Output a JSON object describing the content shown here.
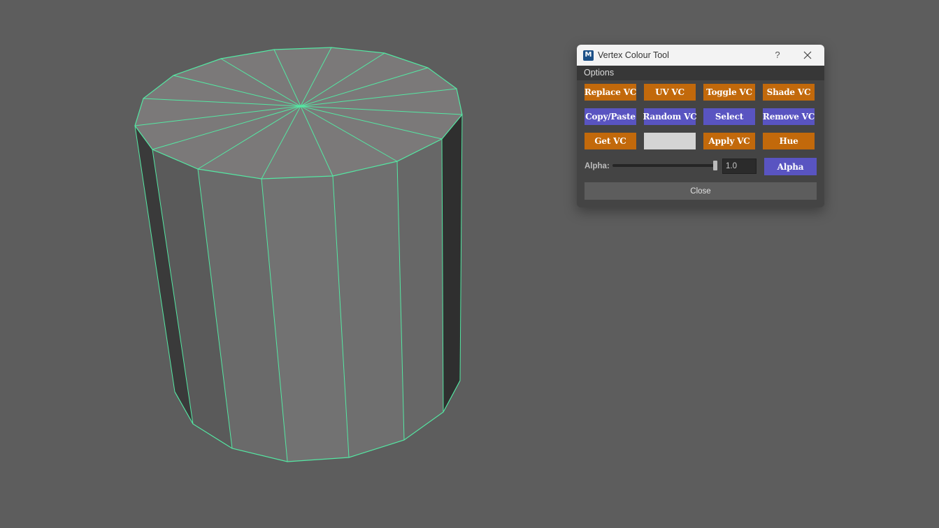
{
  "colors": {
    "viewport_bg": "#5d5d5d",
    "wireframe": "#54e8a3",
    "orange": "#c2690b",
    "purple": "#5954c1",
    "swatch": "#d4d4d4"
  },
  "viewport": {
    "object": "cylinder"
  },
  "window": {
    "title": "Vertex Colour Tool",
    "icon_letter": "M",
    "icon": "maya-app-icon",
    "help_label": "?",
    "close_icon": "close-icon"
  },
  "menu": {
    "options_label": "Options"
  },
  "buttons": {
    "replace_vc": "Replace VC",
    "uv_vc": "UV VC",
    "toggle_vc": "Toggle VC",
    "shade_vc": "Shade VC",
    "copy_paste": "Copy/Paste",
    "random_vc": "Random VC",
    "select": "Select",
    "remove_vc": "Remove VC",
    "get_vc": "Get VC",
    "apply_vc": "Apply VC",
    "hue": "Hue",
    "alpha": "Alpha",
    "close": "Close"
  },
  "alpha": {
    "label": "Alpha:",
    "value": "1.0",
    "slider_fraction": 1.0
  }
}
